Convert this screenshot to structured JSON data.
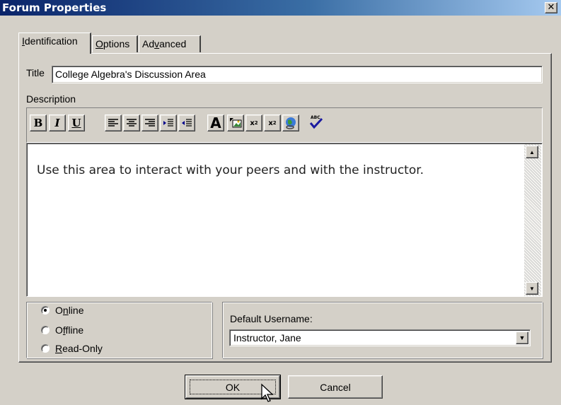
{
  "window": {
    "title": "Forum Properties",
    "close_icon": "close-icon"
  },
  "tabs": [
    {
      "label": "Identification",
      "accel": "I",
      "rest": "dentification",
      "active": true
    },
    {
      "label": "Options",
      "accel": "O",
      "rest": "ptions",
      "active": false
    },
    {
      "label": "Advanced",
      "pre": "Ad",
      "accel": "v",
      "rest": "anced",
      "active": false
    }
  ],
  "identification": {
    "title_label": "Title",
    "title_value": "College Algebra's Discussion Area",
    "description_label": "Description",
    "toolbar": {
      "bold": "B",
      "italic": "I",
      "underline": "U",
      "font": "A",
      "icons": [
        "bold-icon",
        "italic-icon",
        "underline-icon",
        "align-left-icon",
        "align-center-icon",
        "align-right-icon",
        "indent-icon",
        "outdent-icon",
        "font-icon",
        "insert-image-icon",
        "subscript-icon",
        "superscript-icon",
        "insert-link-icon",
        "spell-check-icon"
      ]
    },
    "description_text": "Use this area to interact with your peers and with the instructor.",
    "status": {
      "options": [
        {
          "label": "Online",
          "accel": "n",
          "pre": "O",
          "rest": "line",
          "checked": true
        },
        {
          "label": "Offline",
          "accel": "f",
          "pre": "O",
          "rest": "fline",
          "checked": false
        },
        {
          "label": "Read-Only",
          "accel": "R",
          "pre": "",
          "rest": "ead-Only",
          "checked": false
        }
      ]
    },
    "default_username_label": "Default Username:",
    "default_username_value": "Instructor, Jane"
  },
  "buttons": {
    "ok": "OK",
    "cancel": "Cancel"
  },
  "colors": {
    "titlebar_start": "#0a246a",
    "titlebar_end": "#a6caf0",
    "face": "#d4d0c8"
  }
}
